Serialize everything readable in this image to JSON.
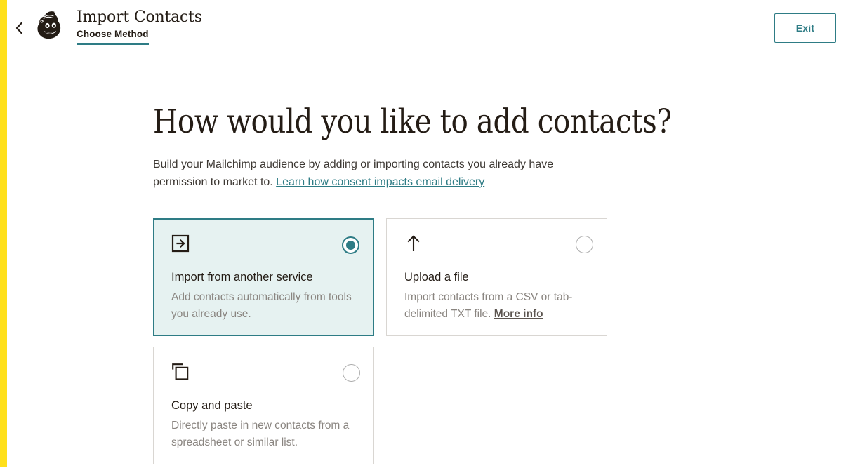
{
  "chrome": {
    "accent_yellow": "#ffe01b",
    "accent_teal": "#2e7c85"
  },
  "header": {
    "back_icon": "chevron-left-icon",
    "logo_icon": "mailchimp-freddie-logo",
    "title": "Import Contacts",
    "step_label": "Choose Method",
    "exit_label": "Exit"
  },
  "main": {
    "heading": "How would you like to add contacts?",
    "description_text": "Build your Mailchimp audience by adding or importing contacts you already have permission to market to. ",
    "description_link": "Learn how consent impacts email delivery"
  },
  "options": [
    {
      "icon": "import-into-box-icon",
      "title": "Import from another service",
      "description": "Add contacts automatically from tools you already use.",
      "link": "",
      "selected": true
    },
    {
      "icon": "arrow-up-icon",
      "title": "Upload a file",
      "description": "Import contacts from a CSV or tab-delimited TXT file. ",
      "link": "More info",
      "selected": false
    },
    {
      "icon": "copy-paste-icon",
      "title": "Copy and paste",
      "description": "Directly paste in new contacts from a spreadsheet or similar list.",
      "link": "",
      "selected": false
    }
  ]
}
